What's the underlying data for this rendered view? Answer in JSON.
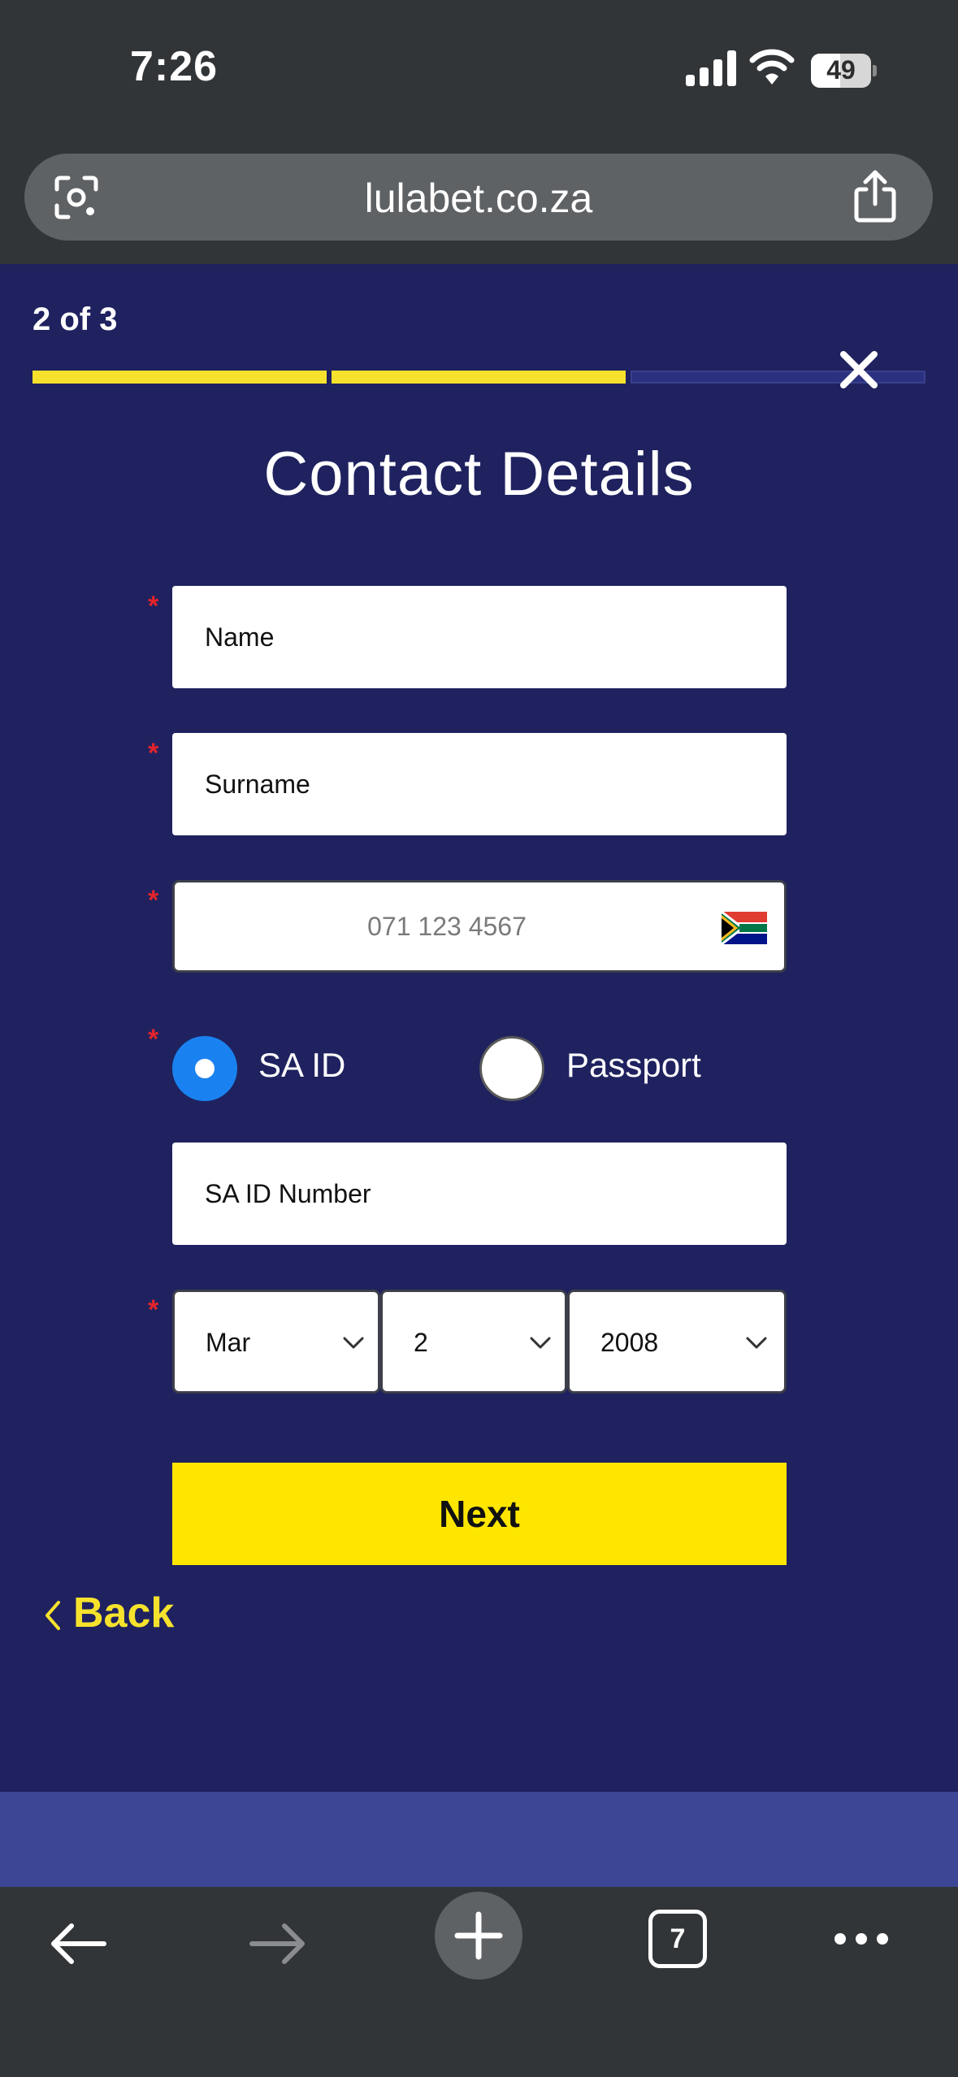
{
  "status_bar": {
    "time": "7:26",
    "battery_level": "49"
  },
  "browser": {
    "url": "lulabet.co.za",
    "open_tabs": "7"
  },
  "step": {
    "label": "2 of 3",
    "current": 2,
    "total": 3
  },
  "form": {
    "title": "Contact Details",
    "name_placeholder": "Name",
    "surname_placeholder": "Surname",
    "phone_placeholder": "071 123 4567",
    "id_type": {
      "options": [
        "SA ID",
        "Passport"
      ],
      "selected": "SA ID"
    },
    "id_number_placeholder": "SA ID Number",
    "dob": {
      "month": "Mar",
      "day": "2",
      "year": "2008"
    },
    "next_label": "Next",
    "back_label": "Back"
  },
  "colors": {
    "background": "#1f225f",
    "accent_yellow": "#ffe600",
    "radio_blue": "#1a82f0",
    "required_red": "#e3242b"
  }
}
